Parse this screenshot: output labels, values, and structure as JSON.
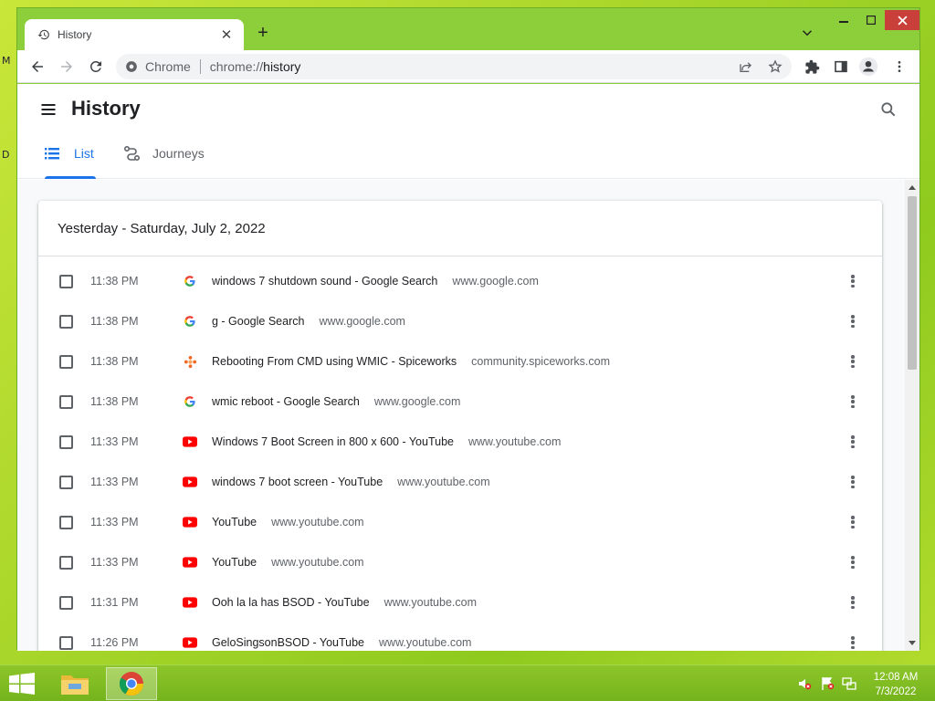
{
  "desktop": {
    "glyph_top": "M",
    "glyph_mid": "D"
  },
  "tab": {
    "title": "History",
    "close": "✕"
  },
  "newtab": "+",
  "omnibox": {
    "chip": "Chrome",
    "scheme": "chrome://",
    "host": "history"
  },
  "header": {
    "title": "History"
  },
  "tabs": [
    {
      "label": "List",
      "active": true
    },
    {
      "label": "Journeys",
      "active": false
    }
  ],
  "group": {
    "title": "Yesterday - Saturday, July 2, 2022"
  },
  "rows": [
    {
      "time": "11:38 PM",
      "favicon": "google-icon",
      "title": "windows 7 shutdown sound - Google Search",
      "domain": "www.google.com"
    },
    {
      "time": "11:38 PM",
      "favicon": "google-icon",
      "title": "g - Google Search",
      "domain": "www.google.com"
    },
    {
      "time": "11:38 PM",
      "favicon": "spiceworks-icon",
      "title": "Rebooting From CMD using WMIC - Spiceworks",
      "domain": "community.spiceworks.com"
    },
    {
      "time": "11:38 PM",
      "favicon": "google-icon",
      "title": "wmic reboot - Google Search",
      "domain": "www.google.com"
    },
    {
      "time": "11:33 PM",
      "favicon": "youtube-icon",
      "title": "Windows 7 Boot Screen in 800 x 600 - YouTube",
      "domain": "www.youtube.com"
    },
    {
      "time": "11:33 PM",
      "favicon": "youtube-icon",
      "title": "windows 7 boot screen - YouTube",
      "domain": "www.youtube.com"
    },
    {
      "time": "11:33 PM",
      "favicon": "youtube-icon",
      "title": "YouTube",
      "domain": "www.youtube.com"
    },
    {
      "time": "11:33 PM",
      "favicon": "youtube-icon",
      "title": "YouTube",
      "domain": "www.youtube.com"
    },
    {
      "time": "11:31 PM",
      "favicon": "youtube-icon",
      "title": "Ooh la la has BSOD - YouTube",
      "domain": "www.youtube.com"
    },
    {
      "time": "11:26 PM",
      "favicon": "youtube-icon",
      "title": "GeloSingsonBSOD - YouTube",
      "domain": "www.youtube.com"
    }
  ],
  "taskbar": {
    "clock_time": "12:08 AM",
    "clock_date": "7/3/2022"
  },
  "colors": {
    "accent": "#1a73e8",
    "youtube": "#ff0000",
    "google_blue": "#4285f4",
    "spiceworks": "#f26722"
  }
}
